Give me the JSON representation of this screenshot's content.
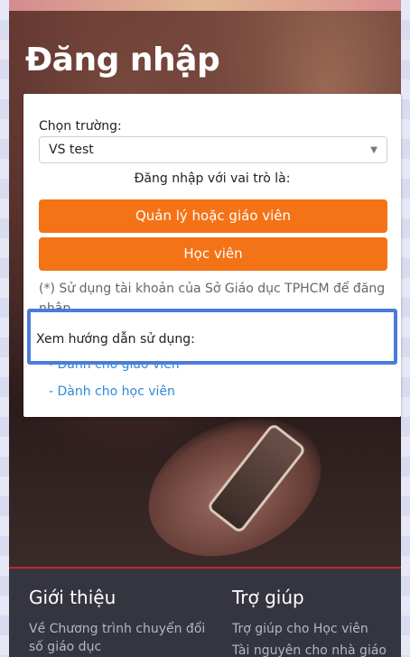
{
  "page_title": "Đăng nhập",
  "login": {
    "school_label": "Chọn trường:",
    "school_selected": "VS test",
    "role_label": "Đăng nhập với vai trò là:",
    "teacher_button": "Quản lý hoặc giáo viên",
    "student_button": "Học viên",
    "note": "(*) Sử dụng tài khoản của Sở Giáo dục TPHCM để đăng nhập",
    "guide_label": "Xem hướng dẫn sử dụng:",
    "guide_links": [
      "- Dành cho giáo viên",
      "- Dành cho học viên"
    ]
  },
  "footer": {
    "about_title": "Giới thiệu",
    "about_link": "Về Chương trình chuyển đổi số giáo dục",
    "help_title": "Trợ giúp",
    "help_links": [
      "Trợ giúp cho Học viên",
      "Tài nguyên cho nhà giáo"
    ]
  },
  "colors": {
    "accent_orange": "#f47316",
    "link_blue": "#2f8ad6",
    "highlight_blue": "#4a7cd9",
    "footer_bg": "#353540"
  }
}
